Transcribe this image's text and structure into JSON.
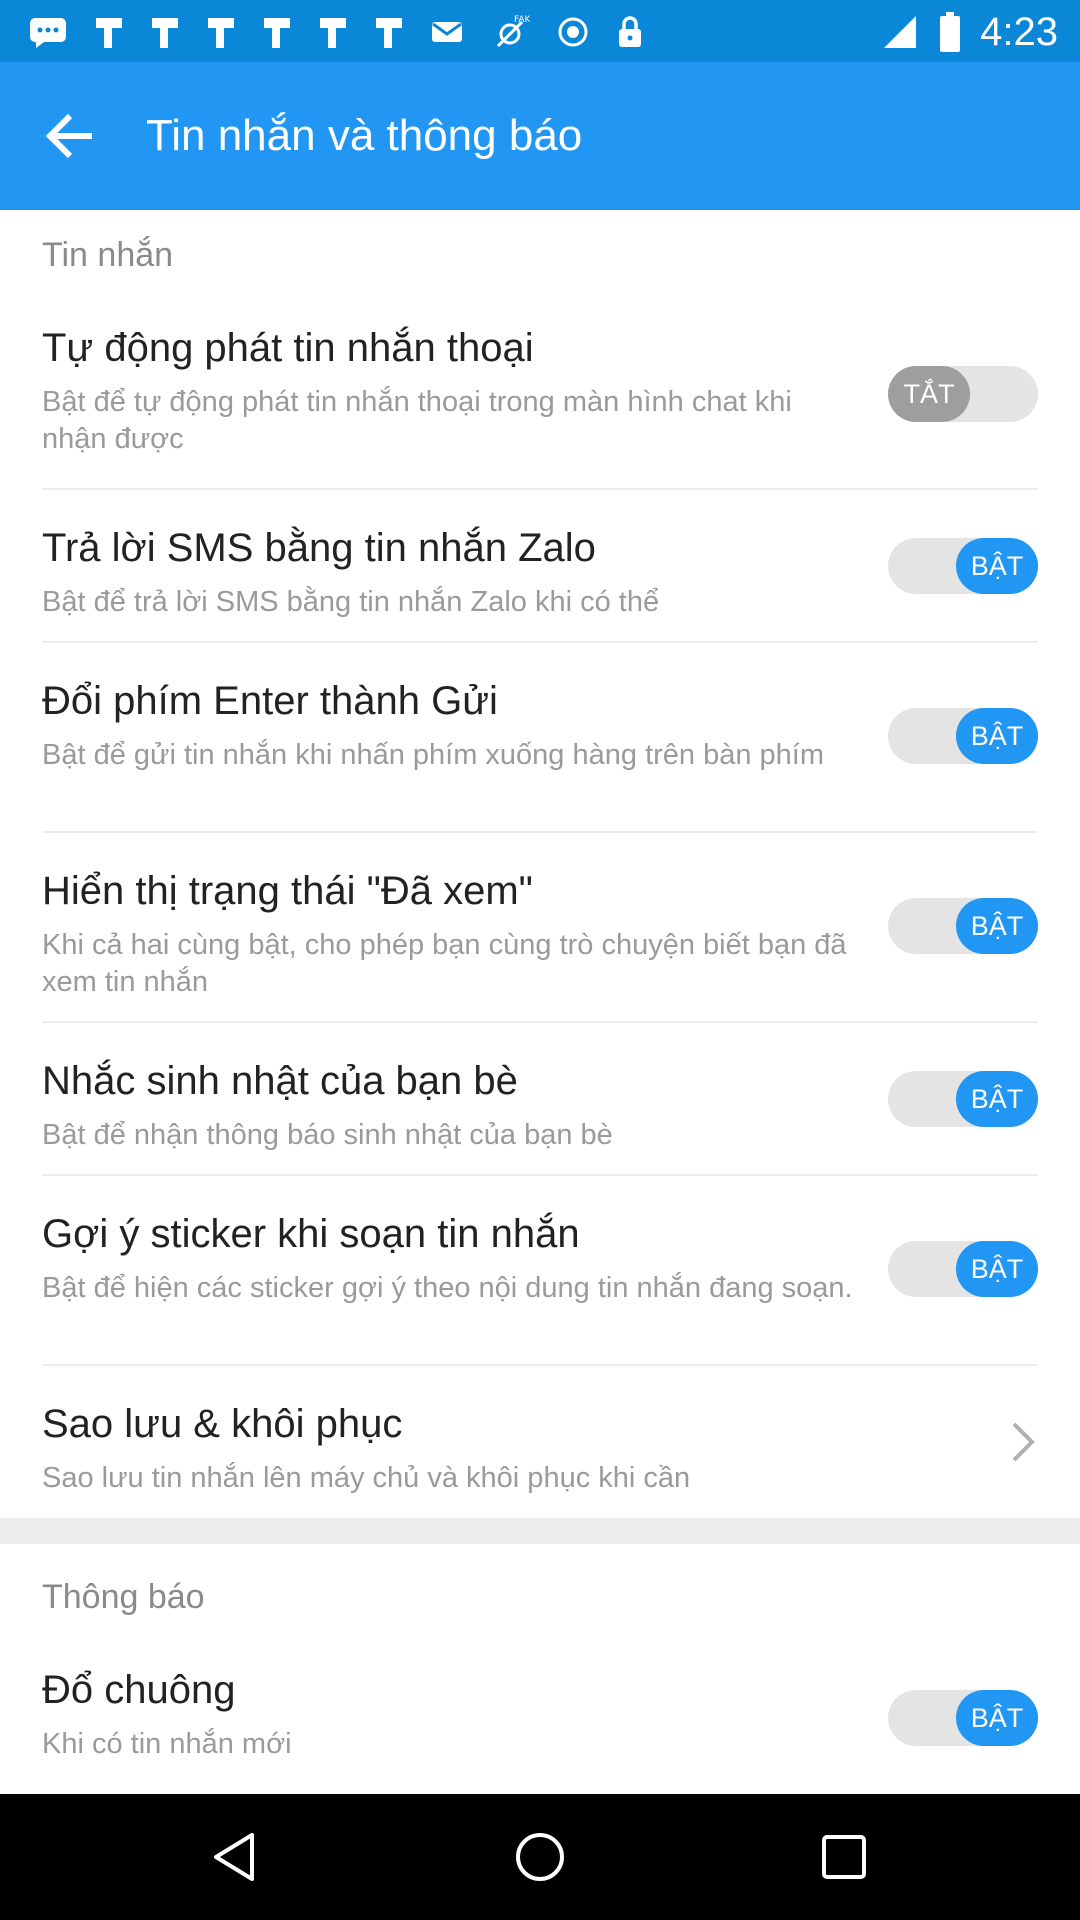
{
  "status_bar": {
    "time": "4:23",
    "left_icons": [
      "messages-icon",
      "notification-icon",
      "notification-icon",
      "notification-icon",
      "notification-icon",
      "notification-icon",
      "notification-icon",
      "mail-icon",
      "fake-gps-icon",
      "circle-icon",
      "lock-icon"
    ],
    "right_icons": [
      "signal-icon",
      "battery-icon"
    ]
  },
  "app_bar": {
    "title": "Tin nhắn và thông báo",
    "back_icon": "back-arrow-icon",
    "color": "#2196f3"
  },
  "sections": {
    "messages": {
      "header": "Tin nhắn",
      "items": [
        {
          "title": "Tự động phát tin nhắn thoại",
          "desc": "Bật để tự động phát tin nhắn thoại trong màn hình chat khi nhận được",
          "toggle": "TẮT",
          "state": "off"
        },
        {
          "title": "Trả lời SMS bằng tin nhắn Zalo",
          "desc": "Bật để trả lời SMS bằng tin nhắn Zalo khi có thể",
          "toggle": "BẬT",
          "state": "on"
        },
        {
          "title": "Đổi phím Enter thành Gửi",
          "desc": "Bật để gửi tin nhắn khi nhấn phím xuống hàng trên bàn phím",
          "toggle": "BẬT",
          "state": "on"
        },
        {
          "title": "Hiển thị trạng thái \"Đã xem\"",
          "desc": "Khi cả hai cùng bật, cho phép bạn cùng trò chuyện biết bạn đã xem tin nhắn",
          "toggle": "BẬT",
          "state": "on"
        },
        {
          "title": "Nhắc sinh nhật của bạn bè",
          "desc": "Bật để nhận thông báo sinh nhật của bạn bè",
          "toggle": "BẬT",
          "state": "on"
        },
        {
          "title": "Gợi ý sticker khi soạn tin nhắn",
          "desc": "Bật để hiện các sticker gợi ý theo nội dung tin nhắn đang soạn.",
          "toggle": "BẬT",
          "state": "on"
        }
      ],
      "backup": {
        "title": "Sao lưu & khôi phục",
        "desc": "Sao lưu tin nhắn lên máy chủ và khôi phục khi cần",
        "icon": "chevron-right-icon"
      }
    },
    "notifications": {
      "header": "Thông báo",
      "items": [
        {
          "title": "Đổ chuông",
          "desc": "Khi có tin nhắn mới",
          "toggle": "BẬT",
          "state": "on"
        }
      ]
    }
  },
  "nav_bar": {
    "back": "nav-back-icon",
    "home": "nav-home-icon",
    "recents": "nav-recents-icon"
  }
}
